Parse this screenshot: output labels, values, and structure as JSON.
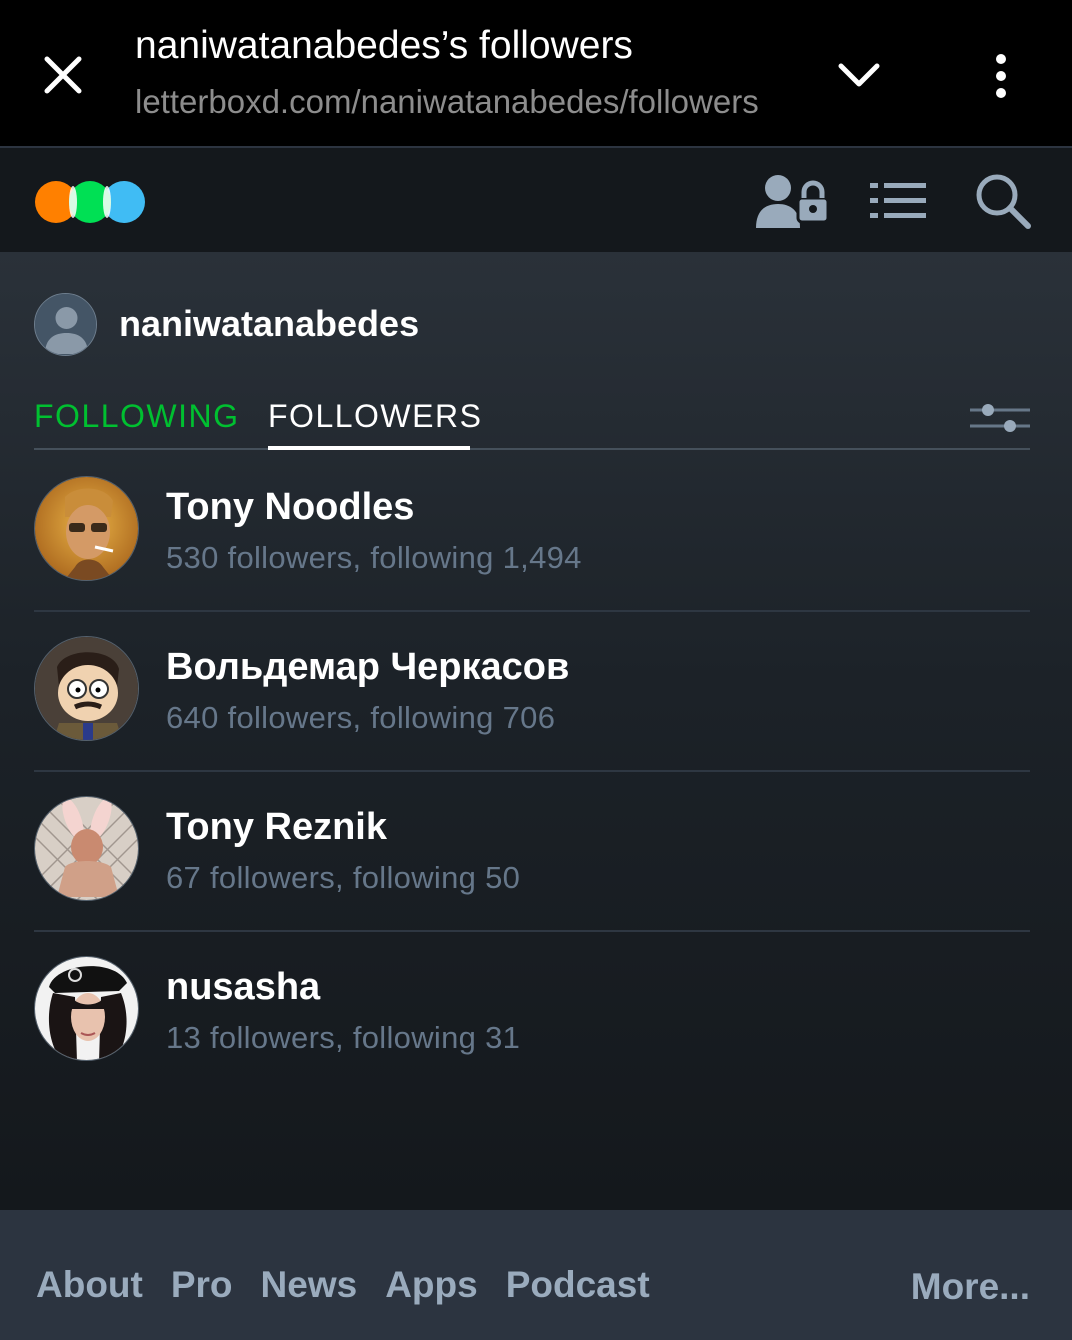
{
  "browser": {
    "title": "naniwatanabedes’s followers",
    "url": "letterboxd.com/naniwatanabedes/followers"
  },
  "header": {
    "logo_colors": [
      "#ff8000",
      "#00e054",
      "#40bcf4"
    ],
    "icons": [
      "account-lock-icon",
      "list-menu-icon",
      "search-icon"
    ]
  },
  "profile": {
    "username": "naniwatanabedes"
  },
  "tabs": {
    "following_label": "FOLLOWING",
    "followers_label": "FOLLOWERS",
    "active_tab": "FOLLOWERS",
    "accent_color": "#00c030"
  },
  "users": [
    {
      "name": "Tony Noodles",
      "stats": "530 followers, following 1,494"
    },
    {
      "name": "Вольдемар Черкасов",
      "stats": "640 followers, following 706"
    },
    {
      "name": "Tony Reznik",
      "stats": "67 followers, following 50"
    },
    {
      "name": "nusasha",
      "stats": "13 followers, following 31"
    }
  ],
  "footer": {
    "links": [
      "About",
      "Pro",
      "News",
      "Apps",
      "Podcast"
    ],
    "more_label": "More..."
  }
}
